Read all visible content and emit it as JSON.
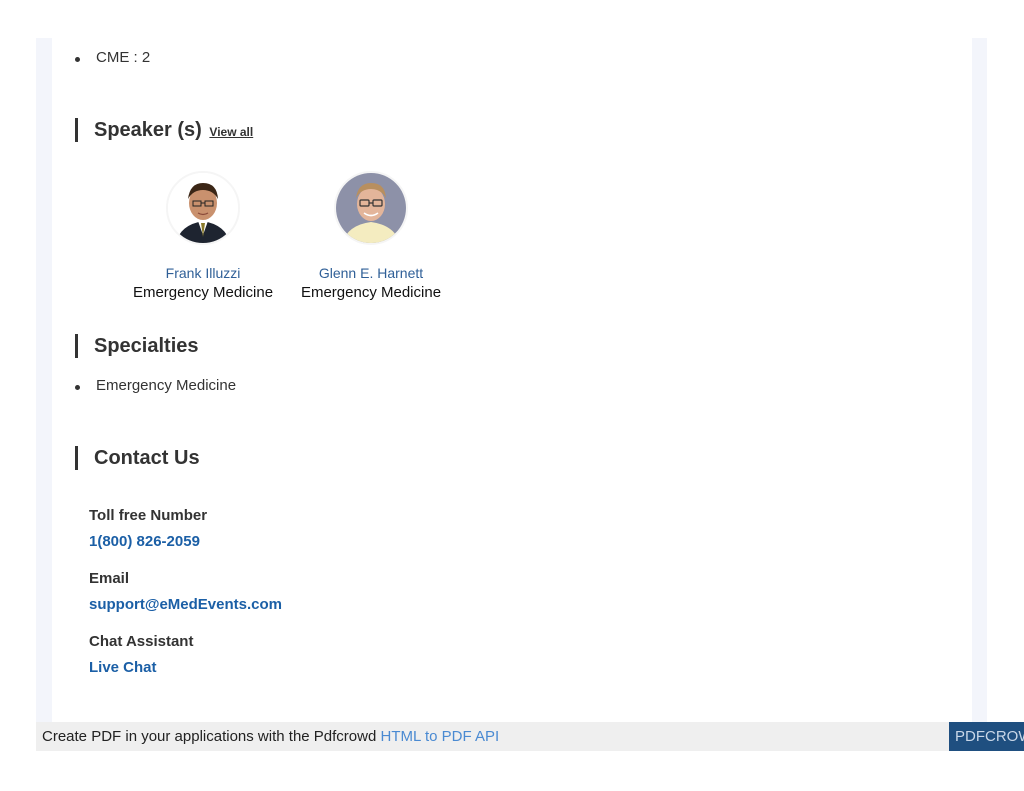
{
  "cme": {
    "label": "CME : 2"
  },
  "speakers_section": {
    "title": "Speaker (s)",
    "view_all": "View all",
    "speakers": [
      {
        "name": "Frank Illuzzi",
        "specialty": "Emergency Medicine"
      },
      {
        "name": "Glenn E. Harnett",
        "specialty": "Emergency Medicine"
      }
    ]
  },
  "specialties_section": {
    "title": "Specialties",
    "items": [
      "Emergency Medicine"
    ]
  },
  "contact_section": {
    "title": "Contact Us",
    "toll_free_label": "Toll free Number",
    "toll_free_value": "1(800) 826-2059",
    "email_label": "Email",
    "email_value": "support@eMedEvents.com",
    "chat_label": "Chat Assistant",
    "chat_value": "Live Chat"
  },
  "pdf_bar": {
    "text": "Create PDF in your applications with the Pdfcrowd",
    "link": "HTML to PDF API",
    "brand": "PDFCROWD"
  },
  "colors": {
    "link_blue": "#1b5fa6",
    "speaker_name_blue": "#2f5f97",
    "pdf_brand_bg": "#1f4f80"
  }
}
